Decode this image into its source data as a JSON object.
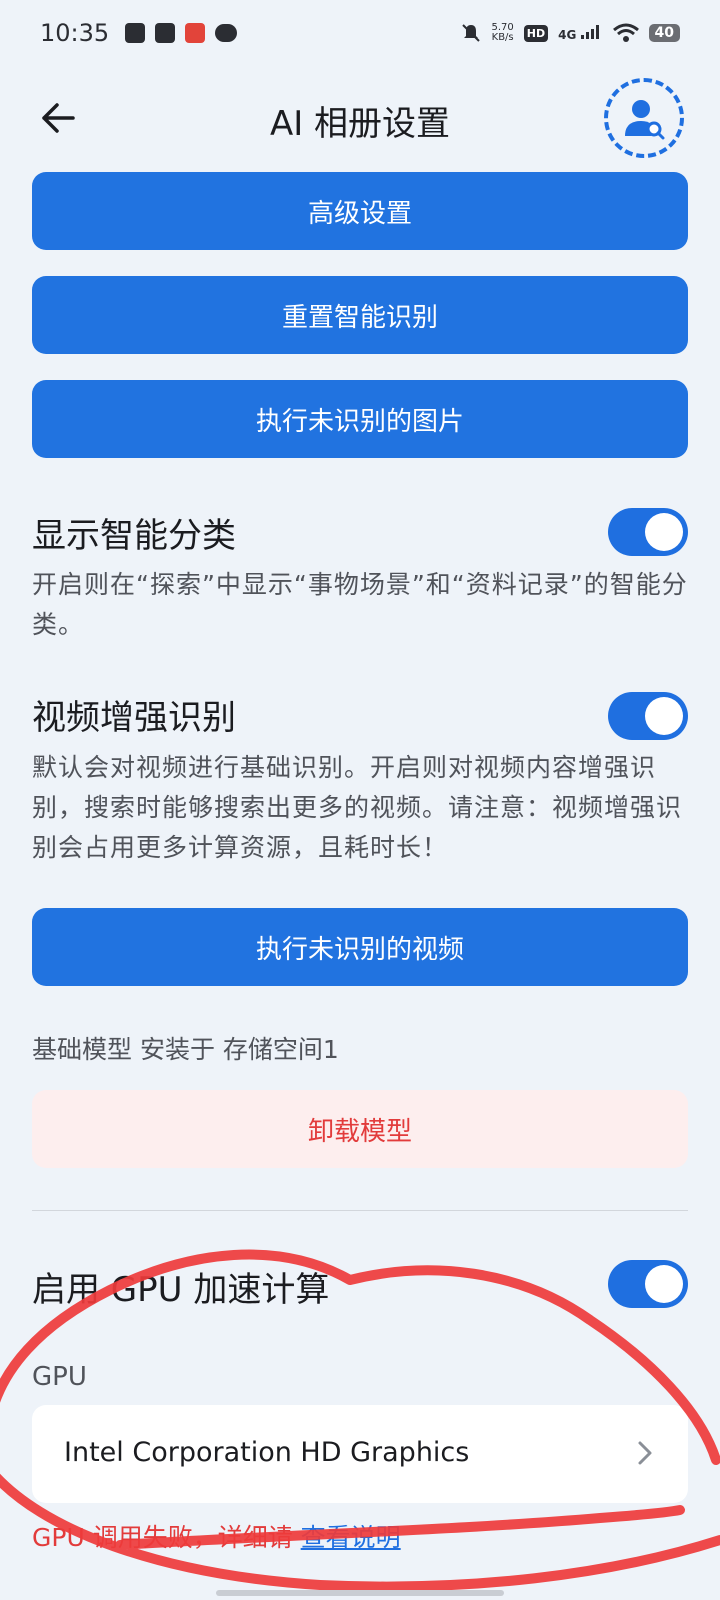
{
  "status_bar": {
    "time": "10:35",
    "net_speed": "5.70",
    "net_unit": "KB/s",
    "hd": "HD",
    "signal": "4G",
    "battery": "40"
  },
  "header": {
    "title": "AI 相册设置"
  },
  "buttons": {
    "advanced": "高级设置",
    "reset": "重置智能识别",
    "run_images": "执行未识别的图片",
    "run_videos": "执行未识别的视频",
    "uninstall": "卸载模型"
  },
  "smart_category": {
    "title": "显示智能分类",
    "desc": "开启则在“探索”中显示“事物场景”和“资料记录”的智能分类。",
    "enabled": true
  },
  "video_enhance": {
    "title": "视频增强识别",
    "desc": "默认会对视频进行基础识别。开启则对视频内容增强识别，搜索时能够搜索出更多的视频。请注意：视频增强识别会占用更多计算资源，且耗时长！",
    "enabled": true
  },
  "model": {
    "info": "基础模型 安装于 存储空间1"
  },
  "gpu": {
    "title": "启用 GPU 加速计算",
    "enabled": true,
    "label": "GPU",
    "device_name": "Intel Corporation HD Graphics",
    "error_text": "GPU 调用失败，详细请 ",
    "error_link": "查看说明"
  },
  "colors": {
    "accent": "#1f6fe0",
    "danger": "#e23b3b",
    "annotation": "#ee3b3b"
  }
}
